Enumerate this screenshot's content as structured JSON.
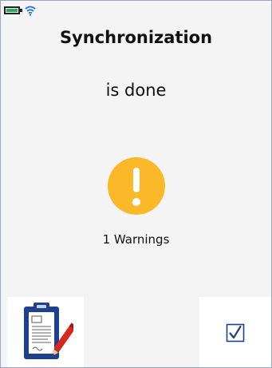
{
  "status_bar": {
    "battery_icon": "battery-icon",
    "battery_level": 1.0,
    "wifi_icon": "wifi-icon"
  },
  "main": {
    "title": "Synchronization",
    "subtitle": "is done",
    "status_icon": "warning-exclamation-icon",
    "warnings_text": "1 Warnings"
  },
  "actions": {
    "report_icon": "clipboard-pen-icon",
    "confirm_icon": "checkbox-checked-icon"
  },
  "colors": {
    "warning": "#fbb828",
    "battery_fill": "#23b14d",
    "wifi": "#1777c8",
    "clipboard": "#1f3f8f",
    "pen": "#d7271f",
    "check": "#1f3f8f"
  }
}
